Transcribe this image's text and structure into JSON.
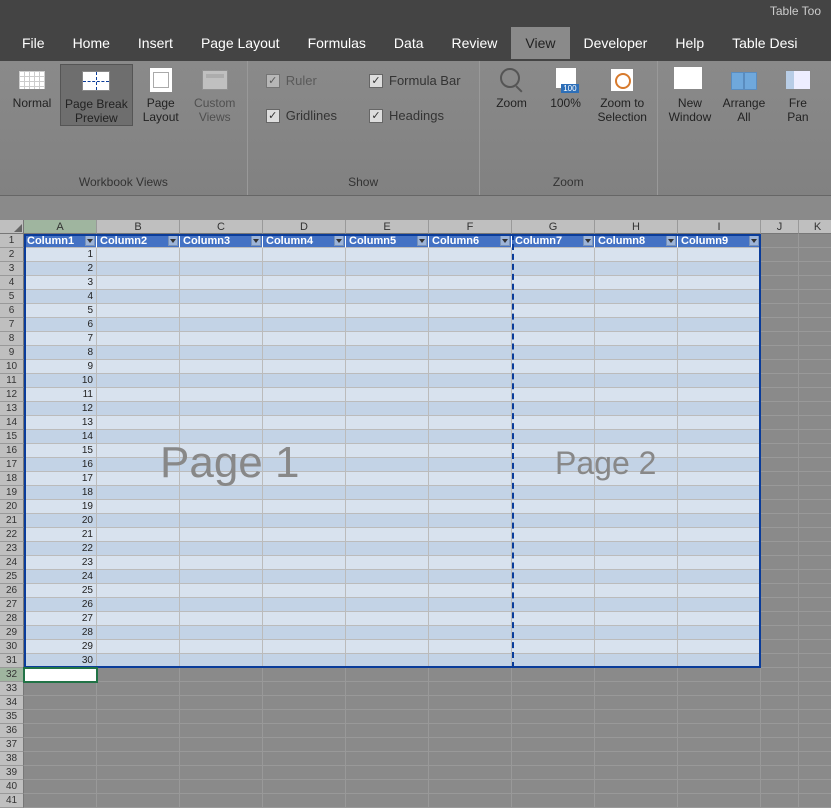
{
  "titlebar": {
    "context_tab": "Table Too"
  },
  "menu": {
    "items": [
      "File",
      "Home",
      "Insert",
      "Page Layout",
      "Formulas",
      "Data",
      "Review",
      "View",
      "Developer",
      "Help",
      "Table Desi"
    ],
    "active": "View"
  },
  "ribbon": {
    "workbook_views": {
      "label": "Workbook Views",
      "normal": "Normal",
      "page_break": "Page Break\nPreview",
      "page_layout": "Page\nLayout",
      "custom": "Custom\nViews"
    },
    "show": {
      "label": "Show",
      "ruler": "Ruler",
      "formula_bar": "Formula Bar",
      "gridlines": "Gridlines",
      "headings": "Headings"
    },
    "zoom": {
      "label": "Zoom",
      "zoom": "Zoom",
      "hundred": "100%",
      "zoom_sel": "Zoom to\nSelection"
    },
    "window": {
      "new_window": "New\nWindow",
      "arrange": "Arrange\nAll",
      "freeze": "Fre\nPan"
    }
  },
  "grid": {
    "col_letters": [
      "A",
      "B",
      "C",
      "D",
      "E",
      "F",
      "G",
      "H",
      "I",
      "J",
      "K"
    ],
    "table_headers": [
      "Column1",
      "Column2",
      "Column3",
      "Column4",
      "Column5",
      "Column6",
      "Column7",
      "Column8",
      "Column9"
    ],
    "col_a_values": [
      1,
      2,
      3,
      4,
      5,
      6,
      7,
      8,
      9,
      10,
      11,
      12,
      13,
      14,
      15,
      16,
      17,
      18,
      19,
      20,
      21,
      22,
      23,
      24,
      25,
      26,
      27,
      28,
      29,
      30
    ],
    "selected_cell": "A32",
    "row_count": 41,
    "watermarks": {
      "p1": "Page 1",
      "p2": "Page 2"
    }
  }
}
